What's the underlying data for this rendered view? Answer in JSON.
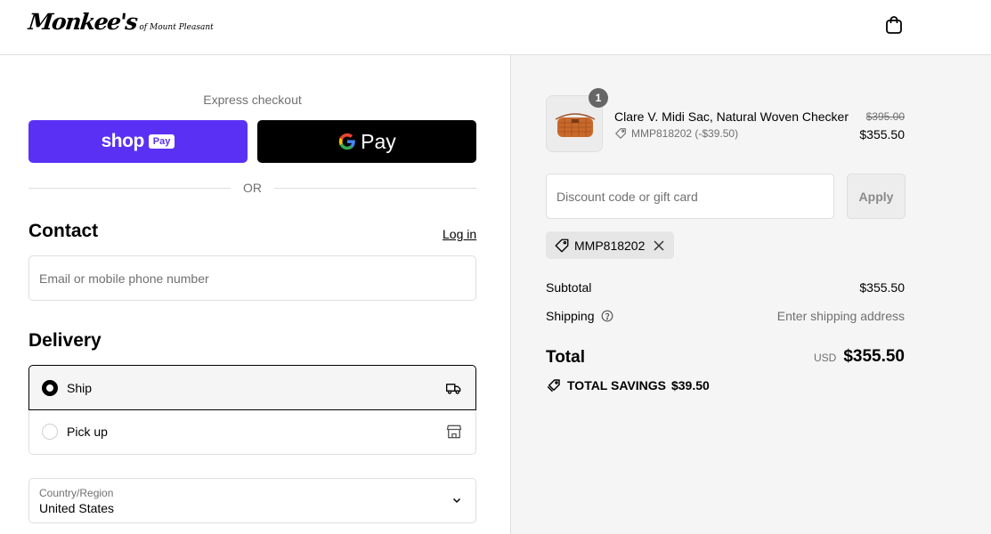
{
  "header": {
    "logo_main": "Monkee's",
    "logo_sub": "of Mount Pleasant",
    "cart_icon": "shopping-bag-icon"
  },
  "express": {
    "label": "Express checkout",
    "shop_pay_word": "shop",
    "shop_pay_badge": "Pay",
    "google_pay_word": "Pay",
    "or": "OR"
  },
  "contact": {
    "title": "Contact",
    "login": "Log in",
    "email_placeholder": "Email or mobile phone number"
  },
  "delivery": {
    "title": "Delivery",
    "options": [
      {
        "label": "Ship",
        "selected": true,
        "icon": "truck-icon"
      },
      {
        "label": "Pick up",
        "selected": false,
        "icon": "store-icon"
      }
    ],
    "country_label": "Country/Region",
    "country_value": "United States"
  },
  "summary": {
    "item": {
      "quantity": "1",
      "name": "Clare V. Midi Sac, Natural Woven Checker",
      "discount": "MMP818202 (-$39.50)",
      "original_price": "$395.00",
      "price": "$355.50"
    },
    "discount_placeholder": "Discount code or gift card",
    "apply": "Apply",
    "applied_code": "MMP818202",
    "subtotal_label": "Subtotal",
    "subtotal_value": "$355.50",
    "shipping_label": "Shipping",
    "shipping_value": "Enter shipping address",
    "total_label": "Total",
    "total_currency": "USD",
    "total_value": "$355.50",
    "savings_label": "TOTAL SAVINGS",
    "savings_value": "$39.50"
  },
  "colors": {
    "shop_pay": "#5a31f4",
    "google_pay": "#000000",
    "summary_bg": "#f5f5f5"
  }
}
